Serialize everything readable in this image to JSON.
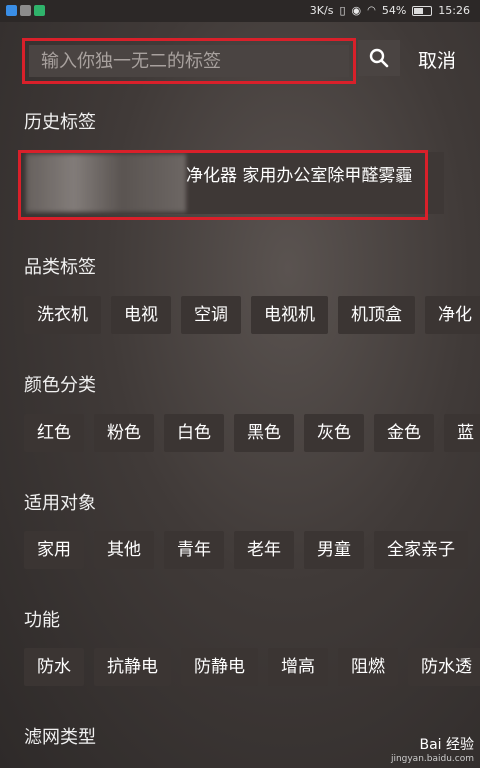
{
  "status_bar": {
    "speed": "3K/s",
    "battery_percent": "54%",
    "time": "15:26",
    "icon_colors": [
      "#3a8ee6",
      "#8c8c8c",
      "#2fb36b"
    ]
  },
  "search": {
    "placeholder": "输入你独一无二的标签",
    "cancel_label": "取消"
  },
  "history": {
    "title": "历史标签",
    "item_visible_text": "净化器 家用办公室除甲醛雾霾"
  },
  "category": {
    "title": "品类标签",
    "chips": [
      "洗衣机",
      "电视",
      "空调",
      "电视机",
      "机顶盒",
      "净化"
    ]
  },
  "color": {
    "title": "颜色分类",
    "chips": [
      "红色",
      "粉色",
      "白色",
      "黑色",
      "灰色",
      "金色",
      "蓝"
    ]
  },
  "audience": {
    "title": "适用对象",
    "chips": [
      "家用",
      "其他",
      "青年",
      "老年",
      "男童",
      "全家亲子"
    ]
  },
  "function": {
    "title": "功能",
    "chips": [
      "防水",
      "抗静电",
      "防静电",
      "增高",
      "阻燃",
      "防水透"
    ]
  },
  "filter": {
    "title": "滤网类型"
  },
  "watermark": {
    "brand": "Bai 经验",
    "url": "jingyan.baidu.com"
  }
}
